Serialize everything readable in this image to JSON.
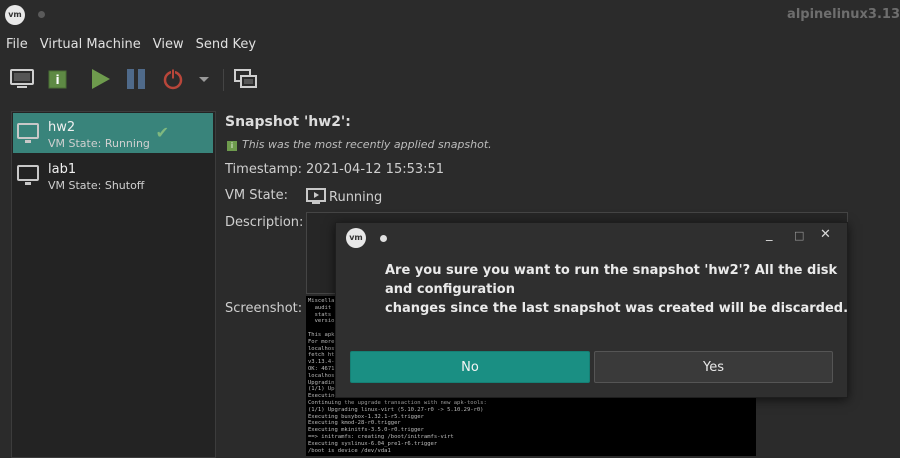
{
  "window": {
    "title": "alpinelinux3.13",
    "logo_text": "vm"
  },
  "menubar": {
    "items": [
      "File",
      "Virtual Machine",
      "View",
      "Send Key"
    ]
  },
  "toolbar": {
    "buttons": [
      "console-icon",
      "details-icon",
      "run-icon",
      "pause-icon",
      "shutdown-icon",
      "shutdown-menu-icon",
      "snapshots-icon"
    ],
    "colors": {
      "run": "#6e9b4d",
      "pause": "#4f6a8a",
      "power": "#b8463a"
    }
  },
  "snapshots": [
    {
      "name": "hw2",
      "state": "VM State: Running",
      "selected": true,
      "current": true
    },
    {
      "name": "lab1",
      "state": "VM State: Shutoff",
      "selected": false,
      "current": false
    }
  ],
  "details": {
    "title": "Snapshot 'hw2':",
    "note": "This was the most recently applied snapshot.",
    "timestamp_label": "Timestamp:",
    "timestamp_value": "2021-04-12 15:53:51",
    "vmstate_label": "VM State:",
    "vmstate_value": "Running",
    "description_label": "Description:",
    "screenshot_label": "Screenshot:",
    "screenshot_text": "Miscellan\n  audit\n  stats\n  versio\n\nThis apk\nFor more\nlocalhost\nfetch ht\nv3.13.4-\nOK: 4671\nlocalhos\nUpgradin\n(1/1) Upgrading ...\nExecuting busybox-1.32.1-r5.trigger\nContinuing the upgrade transaction with new apk-tools:\n(1/1) Upgrading linux-virt (5.10.27-r0 -> 5.10.29-r0)\nExecuting busybox-1.32.1-r5.trigger\nExecuting kmod-28-r0.trigger\nExecuting mkinitfs-3.5.0-r0.trigger\n==> initramfs: creating /boot/initramfs-virt\nExecuting syslinux-6.04_pre1-r6.trigger\n/boot is device /dev/vda1"
  },
  "dialog": {
    "logo_text": "vm",
    "message_lines": [
      "Are you sure you want to run the snapshot 'hw2'? All the disk",
      "and configuration",
      "changes since the last snapshot was created will be discarded."
    ],
    "minimize_glyph": "_",
    "maximize_glyph": "□",
    "close_glyph": "✕",
    "no_label": "No",
    "yes_label": "Yes"
  },
  "colors": {
    "accent": "#39847b",
    "button_primary": "#1a8f83"
  }
}
